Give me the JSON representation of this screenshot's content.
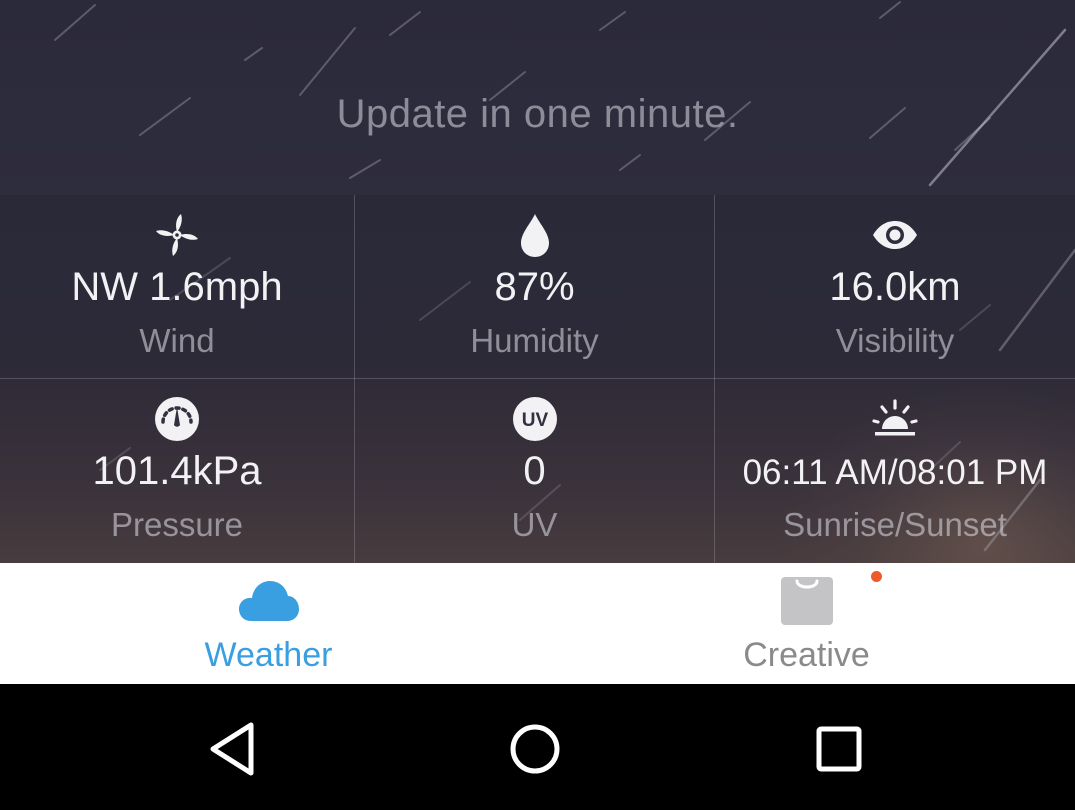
{
  "header": {
    "update_text": "Update in one minute."
  },
  "details": [
    {
      "icon": "wind-fan-icon",
      "value": "NW 1.6mph",
      "label": "Wind"
    },
    {
      "icon": "humidity-drop-icon",
      "value": "87%",
      "label": "Humidity"
    },
    {
      "icon": "eye-icon",
      "value": "16.0km",
      "label": "Visibility"
    },
    {
      "icon": "pressure-gauge-icon",
      "value": "101.4kPa",
      "label": "Pressure"
    },
    {
      "icon": "uv-icon",
      "value": "0",
      "label": "UV",
      "icon_text": "UV"
    },
    {
      "icon": "sunrise-icon",
      "value": "06:11 AM/08:01 PM",
      "label": "Sunrise/Sunset"
    }
  ],
  "tabs": [
    {
      "label": "Weather",
      "icon": "cloud-icon",
      "active": true
    },
    {
      "label": "Creative",
      "icon": "shopping-bag-icon",
      "active": false,
      "has_notification": true
    }
  ],
  "system_nav": {
    "buttons": [
      "back-icon",
      "home-icon",
      "recents-icon"
    ]
  },
  "colors": {
    "active_tab": "#3a9fe0",
    "inactive_tab": "#8a8a8a",
    "notification_dot": "#f05a28",
    "detail_value": "#f2f2f4",
    "detail_label": "#9c9ba6"
  }
}
